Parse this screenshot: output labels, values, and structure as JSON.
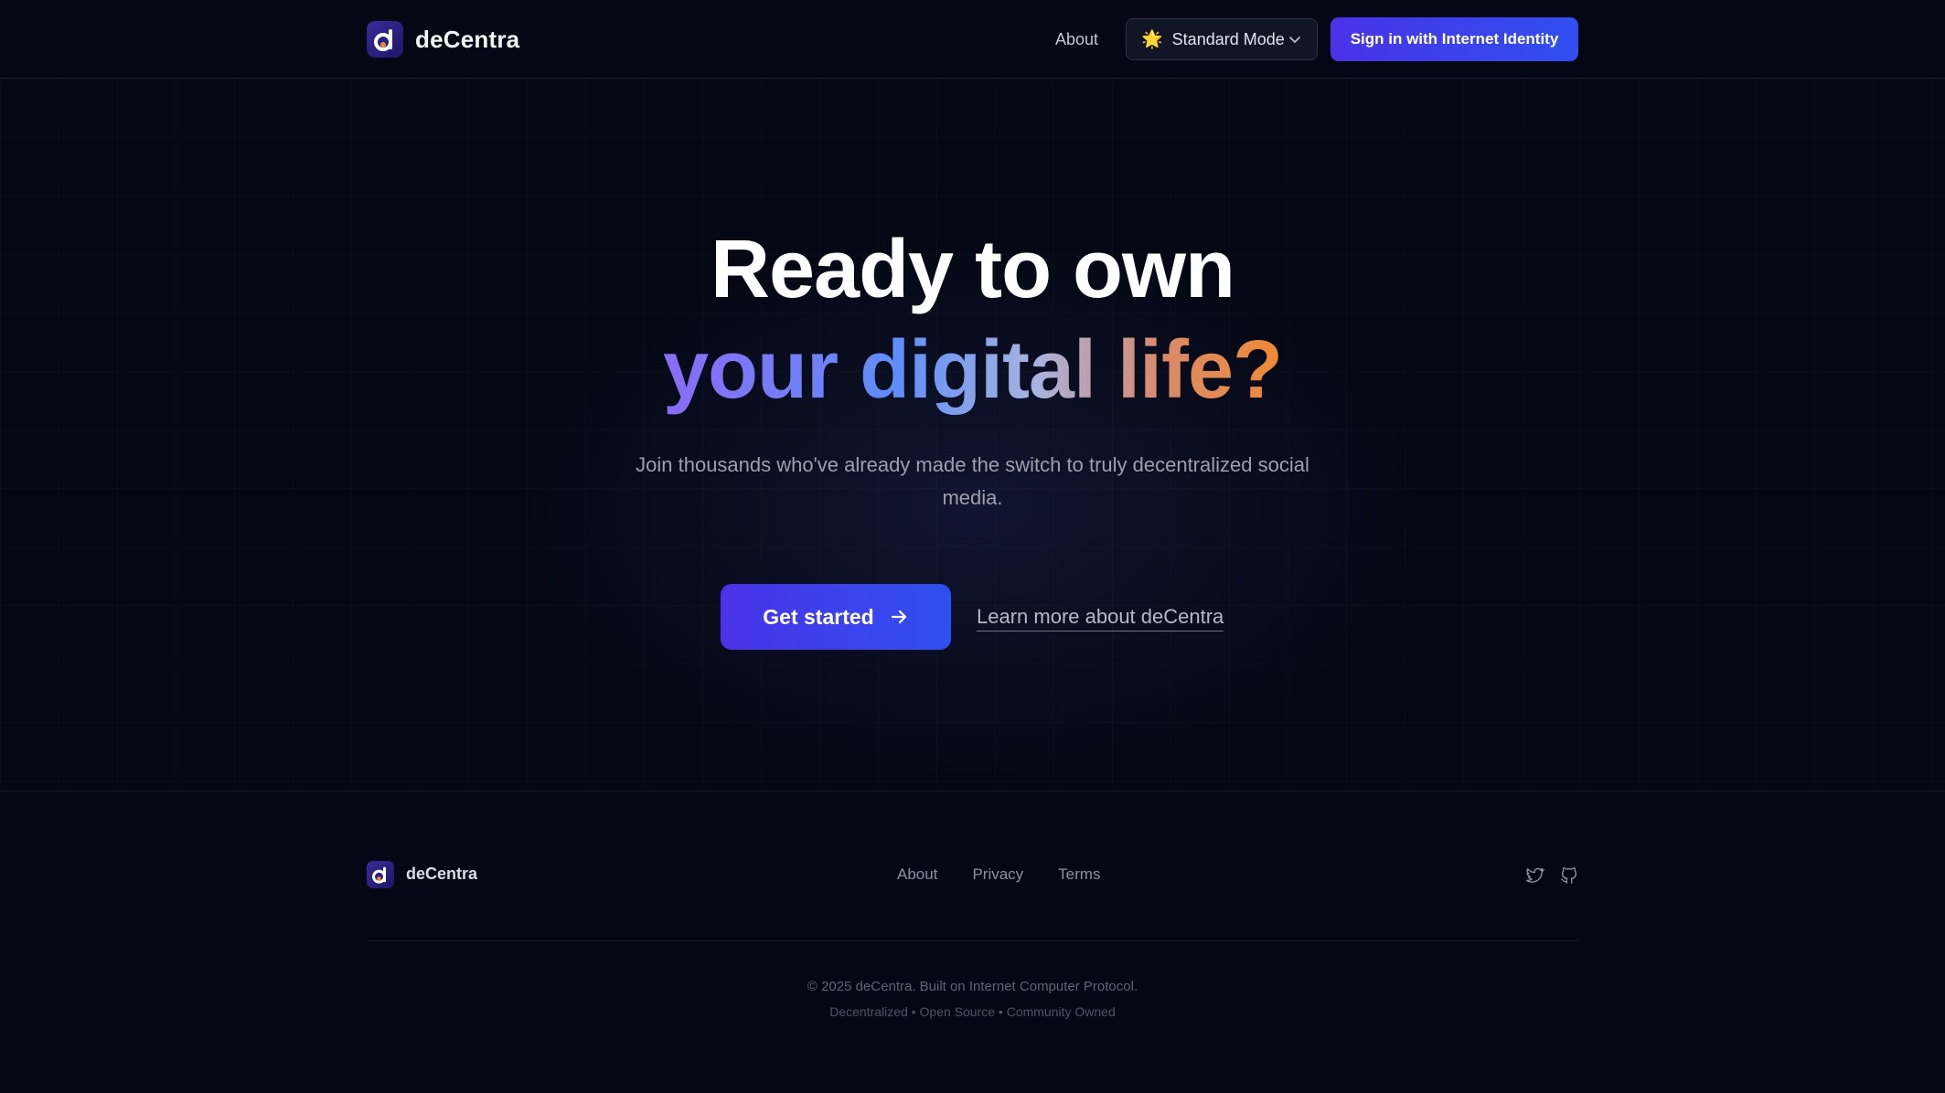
{
  "header": {
    "brand": "deCentra",
    "logo_icon": "decentra-logo-icon",
    "nav_about": "About",
    "mode": {
      "icon": "sun-emoji",
      "icon_glyph": "🌟",
      "label": "Standard Mode"
    },
    "signin_label": "Sign in with Internet Identity"
  },
  "hero": {
    "line1": "Ready to own",
    "line2": "your digital life?",
    "subtitle": "Join thousands who've already made the switch to truly decentralized social media.",
    "cta_label": "Get started",
    "learn_more": "Learn more about deCentra"
  },
  "footer": {
    "brand": "deCentra",
    "links": [
      "About",
      "Privacy",
      "Terms"
    ],
    "social": [
      "twitter-icon",
      "github-icon"
    ],
    "copyright": "© 2025 deCentra. Built on Internet Computer Protocol.",
    "tagline": "Decentralized • Open Source • Community Owned"
  },
  "colors": {
    "background": "#050814",
    "accent_start": "#4a33e8",
    "accent_end": "#2f4ff0",
    "gradient_purple": "#8a6cf5",
    "gradient_blue": "#5f8ef7",
    "gradient_orange": "#f08a34"
  }
}
